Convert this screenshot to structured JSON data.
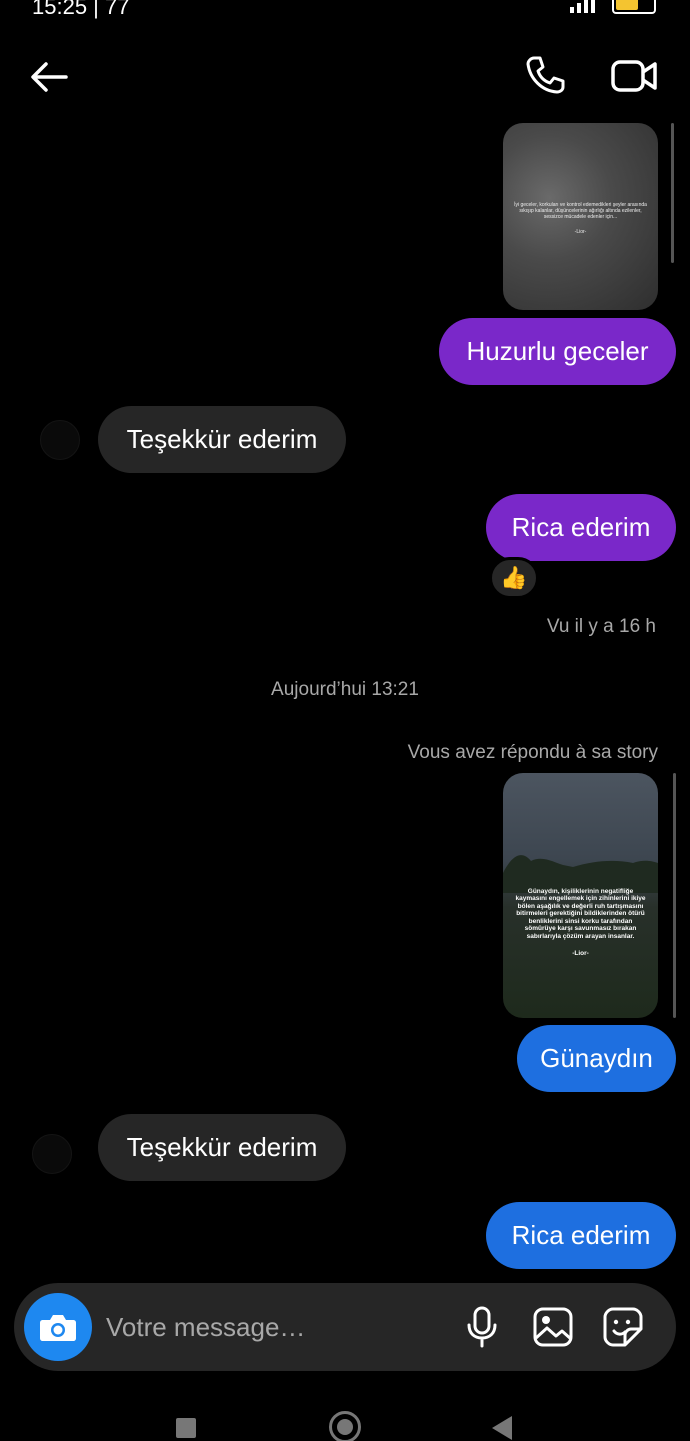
{
  "status_bar": {
    "time": "15:25 | 77",
    "battery_color": "#f4c430"
  },
  "header": {
    "back_icon": "arrow-left-icon",
    "call_icon": "phone-icon",
    "video_icon": "video-camera-icon"
  },
  "messages": [
    {
      "type": "story",
      "id": "story-1",
      "caption": "İyi geceler, korkuları ve kontrol edemedikleri şeyler arasında sıkışıp kalanlar, düşüncelerinin ağırlığı altında ezilenler, sessizce mücadele edenler için...",
      "signature": "-Lior-"
    },
    {
      "type": "sent",
      "text": "Huzurlu geceler",
      "color": "#7a28c9"
    },
    {
      "type": "received",
      "text": "Teşekkür ederim"
    },
    {
      "type": "sent",
      "text": "Rica ederim",
      "color": "#7a28c9",
      "reaction": "👍"
    },
    {
      "type": "status",
      "text": "Vu il y a 16 h"
    },
    {
      "type": "date",
      "text": "Aujourd’hui 13:21"
    },
    {
      "type": "status",
      "text": "Vous avez répondu à sa story"
    },
    {
      "type": "story",
      "id": "story-2",
      "caption": "Günaydın, kişiliklerinin negatifliğe kaymasını engellemek için zihinlerini ikiye bölen aşağılık ve değerli ruh tartışmasını bitirmeleri gerektiğini bildiklerinden ötürü benliklerini sinsi korku tarafından sömürüye karşı savunmasız bırakan sabırlarıyla çözüm arayan insanlar.",
      "signature": "-Lior-"
    },
    {
      "type": "sent",
      "text": "Günaydın",
      "color": "#1e6fe0"
    },
    {
      "type": "received",
      "text": "Teşekkür ederim"
    },
    {
      "type": "sent",
      "text": "Rica ederim",
      "color": "#1e6fe0"
    }
  ],
  "composer": {
    "placeholder": "Votre message…",
    "camera_icon": "camera-icon",
    "mic_icon": "microphone-icon",
    "gallery_icon": "image-icon",
    "sticker_icon": "sticker-icon",
    "camera_color": "#1e88f0"
  }
}
